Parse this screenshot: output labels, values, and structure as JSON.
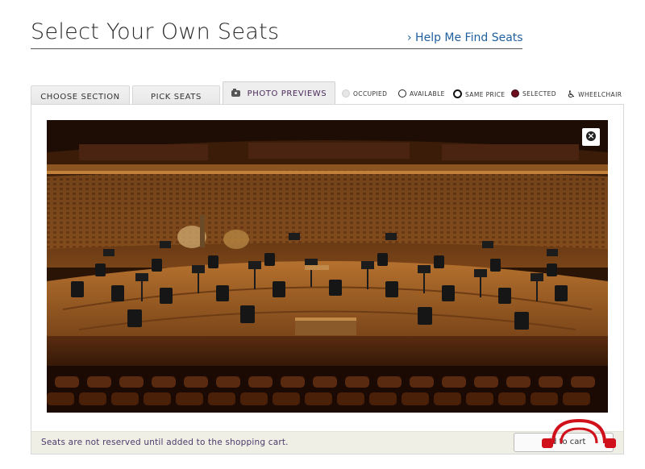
{
  "header": {
    "title": "Select Your Own Seats",
    "help_link": "› Help Me Find Seats"
  },
  "tabs": [
    {
      "label": "CHOOSE SECTION",
      "active": false
    },
    {
      "label": "PICK SEATS",
      "active": false
    },
    {
      "label": "PHOTO PREVIEWS",
      "active": true,
      "icon": "camera-icon"
    }
  ],
  "legend": [
    {
      "label": "OCCUPIED",
      "icon": "occupied-dot-icon",
      "color": "#e6e6e6"
    },
    {
      "label": "AVAILABLE",
      "icon": "available-dot-icon",
      "color": "#ffffff"
    },
    {
      "label": "SAME PRICE",
      "icon": "same-price-dot-icon",
      "color": "#111111"
    },
    {
      "label": "SELECTED",
      "icon": "selected-dot-icon",
      "color": "#6b0f1f"
    },
    {
      "label": "WHEELCHAIR",
      "icon": "wheelchair-icon",
      "color": "#111111"
    }
  ],
  "photo": {
    "close_icon": "close-icon"
  },
  "footer": {
    "note": "Seats are not reserved until added to the shopping cart.",
    "button_label": "add to cart"
  },
  "colors": {
    "accent_link": "#1f5f9e",
    "footer_text": "#4a3a6a",
    "selected": "#6b0f1f",
    "footer_bg": "#efefe6"
  }
}
